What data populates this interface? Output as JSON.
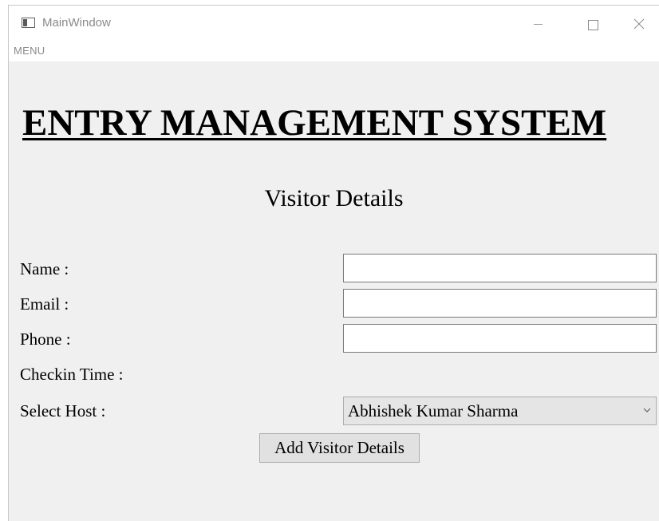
{
  "window": {
    "title": "MainWindow",
    "controls": {
      "minimize": "minimize-icon",
      "maximize": "maximize-icon",
      "close": "close-icon"
    }
  },
  "menu": {
    "items": [
      {
        "label": "MENU"
      }
    ]
  },
  "app": {
    "heading": "ENTRY MANAGEMENT SYSTEM",
    "section_title": "Visitor Details"
  },
  "form": {
    "name_label": "Name :",
    "name_value": "",
    "email_label": "Email :",
    "email_value": "",
    "phone_label": "Phone :",
    "phone_value": "",
    "checkin_label": "Checkin Time :",
    "host_label": "Select Host :",
    "host_selected": "Abhishek Kumar Sharma",
    "submit_label": "Add Visitor Details"
  },
  "colors": {
    "content_background": "#f0f0f0",
    "title_text": "#8a8a8a",
    "button_background": "#e1e1e1",
    "select_background": "#e5e5e5"
  }
}
